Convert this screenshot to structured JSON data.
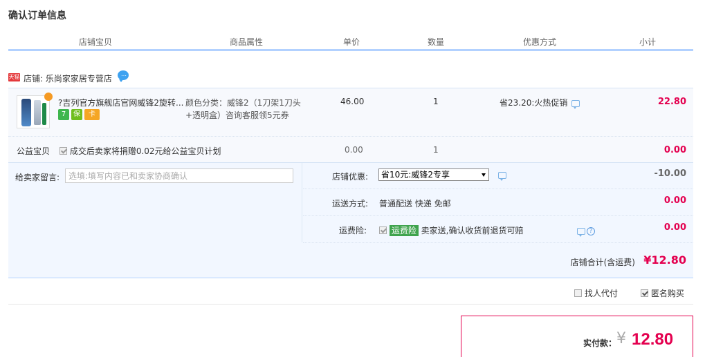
{
  "page_title": "确认订单信息",
  "columns": [
    "店铺宝贝",
    "商品属性",
    "单价",
    "数量",
    "优惠方式",
    "小计"
  ],
  "shop": {
    "badge": "天猫",
    "label": "店铺: 乐尚家家居专营店",
    "chat_icon": "chat-bubble-icon"
  },
  "item": {
    "title": "?吉列官方旗舰店官网威锋2旋转...",
    "service_icons": [
      "7",
      "保",
      "卡"
    ],
    "attr_line1": "颜色分类：威锋2（1刀架1刀头",
    "attr_line2": "+透明盒）咨询客服领5元券",
    "price": "46.00",
    "qty": "1",
    "promo": "省23.20:火热促销",
    "subtotal": "22.80"
  },
  "charity": {
    "label": "公益宝贝",
    "text": "成交后卖家将捐赠0.02元给公益宝贝计划",
    "checked": true,
    "price": "0.00",
    "qty": "1",
    "subtotal": "0.00"
  },
  "message": {
    "label": "给卖家留言:",
    "placeholder": "选填:填写内容已和卖家协商确认",
    "value": ""
  },
  "shop_discount": {
    "label": "店铺优惠:",
    "selected": "省10元:威锋2专享",
    "amount": "-10.00"
  },
  "delivery": {
    "label": "运送方式:",
    "value": "普通配送 快递 免邮",
    "amount": "0.00"
  },
  "insurance": {
    "label": "运费险:",
    "checked": true,
    "tag": "运费险",
    "text": "卖家送,确认收货前退货可赔",
    "amount": "0.00"
  },
  "shop_total": {
    "label": "店铺合计(含运费)",
    "amount": "¥12.80"
  },
  "extras": {
    "proxy_pay": "找人代付",
    "proxy_pay_checked": false,
    "anonymous": "匿名购买",
    "anonymous_checked": true
  },
  "payment": {
    "label": "实付款：",
    "currency": "¥",
    "amount": "12.80"
  },
  "colors": {
    "price_red": "#e4004f",
    "header_rule": "#b2d1ff",
    "panel_bg": "#f2f7ff",
    "tmall_red": "#e4393c"
  }
}
